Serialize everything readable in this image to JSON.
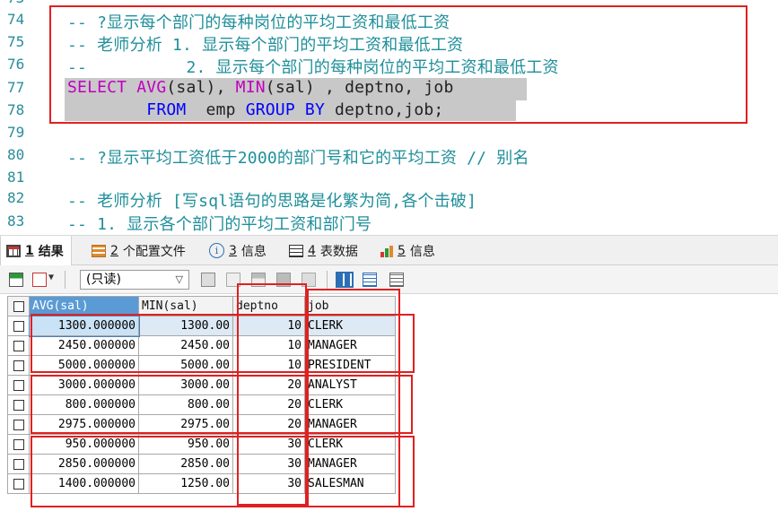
{
  "editor": {
    "lines": [
      {
        "n": "74",
        "text": "-- ?显示每个部门的每种岗位的平均工资和最低工资"
      },
      {
        "n": "75",
        "text": "-- 老师分析 1. 显示每个部门的平均工资和最低工资"
      },
      {
        "n": "76",
        "text": "--          2. 显示每个部门的每种岗位的平均工资和最低工资"
      },
      {
        "n": "77",
        "sql": [
          [
            "fn",
            "SELECT "
          ],
          [
            "fn",
            "AVG"
          ],
          [
            "",
            "(sal), "
          ],
          [
            "fn",
            "MIN"
          ],
          [
            "",
            "(sal) , deptno, job"
          ]
        ]
      },
      {
        "n": "78",
        "sql": [
          [
            "",
            "        "
          ],
          [
            "kw",
            "FROM"
          ],
          [
            "",
            "  emp "
          ],
          [
            "kw",
            "GROUP BY"
          ],
          [
            "",
            " deptno,job;"
          ]
        ]
      },
      {
        "n": "79",
        "text": ""
      },
      {
        "n": "80",
        "text": "-- ?显示平均工资低于2000的部门号和它的平均工资 // 别名"
      },
      {
        "n": "81",
        "text": ""
      },
      {
        "n": "82",
        "text": "-- 老师分析 [写sql语句的思路是化繁为简,各个击破]"
      },
      {
        "n": "83",
        "text": "-- 1. 显示各个部门的平均工资和部门号"
      }
    ]
  },
  "tabs": [
    {
      "num": "1",
      "label": "结果"
    },
    {
      "num": "2",
      "label": "个配置文件"
    },
    {
      "num": "3",
      "label": "信息"
    },
    {
      "num": "4",
      "label": "表数据"
    },
    {
      "num": "5",
      "label": "信息"
    }
  ],
  "toolbar": {
    "mode_select": "(只读)"
  },
  "grid": {
    "columns": [
      "AVG(sal)",
      "MIN(sal)",
      "deptno",
      "job"
    ],
    "rows": [
      [
        "1300.000000",
        "1300.00",
        "10",
        "CLERK"
      ],
      [
        "2450.000000",
        "2450.00",
        "10",
        "MANAGER"
      ],
      [
        "5000.000000",
        "5000.00",
        "10",
        "PRESIDENT"
      ],
      [
        "3000.000000",
        "3000.00",
        "20",
        "ANALYST"
      ],
      [
        "800.000000",
        "800.00",
        "20",
        "CLERK"
      ],
      [
        "2975.000000",
        "2975.00",
        "20",
        "MANAGER"
      ],
      [
        "950.000000",
        "950.00",
        "30",
        "CLERK"
      ],
      [
        "2850.000000",
        "2850.00",
        "30",
        "MANAGER"
      ],
      [
        "1400.000000",
        "1250.00",
        "30",
        "SALESMAN"
      ]
    ]
  },
  "colors": {
    "annotation_red": "#e02020",
    "selected_header": "#5b9bd5",
    "comment": "#1f8f9a",
    "keyword": "#0000ff",
    "function": "#c000c0"
  }
}
